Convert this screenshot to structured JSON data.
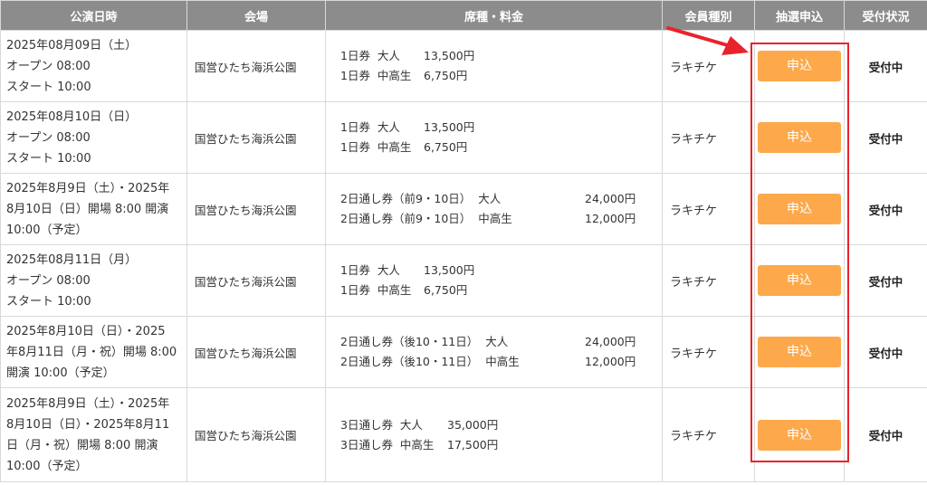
{
  "headers": {
    "date": "公演日時",
    "venue": "会場",
    "seat": "席種・料金",
    "member": "会員種別",
    "apply": "抽選申込",
    "status": "受付状況"
  },
  "rows": [
    {
      "date": "2025年08月09日（土）\nオープン 08:00\nスタート 10:00",
      "venue": "国営ひたち海浜公園",
      "layout": "narrow",
      "seats": [
        {
          "name": "1日券  大人",
          "price": "13,500円"
        },
        {
          "name": "1日券  中高生",
          "price": "6,750円"
        }
      ],
      "member": "ラキチケ",
      "apply_label": "申込",
      "status": "受付中"
    },
    {
      "date": "2025年08月10日（日）\nオープン 08:00\nスタート 10:00",
      "venue": "国営ひたち海浜公園",
      "layout": "narrow",
      "seats": [
        {
          "name": "1日券  大人",
          "price": "13,500円"
        },
        {
          "name": "1日券  中高生",
          "price": "6,750円"
        }
      ],
      "member": "ラキチケ",
      "apply_label": "申込",
      "status": "受付中"
    },
    {
      "date": "2025年8月9日（土）・2025年\n8月10日（日）開場 8:00 開演\n10:00（予定）",
      "venue": "国営ひたち海浜公園",
      "layout": "wide",
      "seats": [
        {
          "name": "2日通し券（前9・10日）  大人",
          "price": "24,000円"
        },
        {
          "name": "2日通し券（前9・10日）  中高生",
          "price": "12,000円"
        }
      ],
      "member": "ラキチケ",
      "apply_label": "申込",
      "status": "受付中"
    },
    {
      "date": "2025年08月11日（月）\nオープン 08:00\nスタート 10:00",
      "venue": "国営ひたち海浜公園",
      "layout": "narrow",
      "seats": [
        {
          "name": "1日券  大人",
          "price": "13,500円"
        },
        {
          "name": "1日券  中高生",
          "price": "6,750円"
        }
      ],
      "member": "ラキチケ",
      "apply_label": "申込",
      "status": "受付中"
    },
    {
      "date": "2025年8月10日（日）・2025\n年8月11日（月・祝）開場 8:00\n開演 10:00（予定）",
      "venue": "国営ひたち海浜公園",
      "layout": "wide",
      "seats": [
        {
          "name": "2日通し券（後10・11日）  大人",
          "price": "24,000円"
        },
        {
          "name": "2日通し券（後10・11日）  中高生",
          "price": "12,000円"
        }
      ],
      "member": "ラキチケ",
      "apply_label": "申込",
      "status": "受付中"
    },
    {
      "date": "2025年8月9日（土）・2025年\n8月10日（日）・2025年8月11\n日（月・祝）開場 8:00 開演\n10:00（予定）",
      "venue": "国営ひたち海浜公園",
      "layout": "mid",
      "seats": [
        {
          "name": "3日通し券  大人",
          "price": "35,000円"
        },
        {
          "name": "3日通し券  中高生",
          "price": "17,500円"
        }
      ],
      "member": "ラキチケ",
      "apply_label": "申込",
      "status": "受付中"
    }
  ],
  "colors": {
    "header_bg": "#8c8c8c",
    "button_bg": "#fda94b",
    "highlight": "#e8232c"
  }
}
